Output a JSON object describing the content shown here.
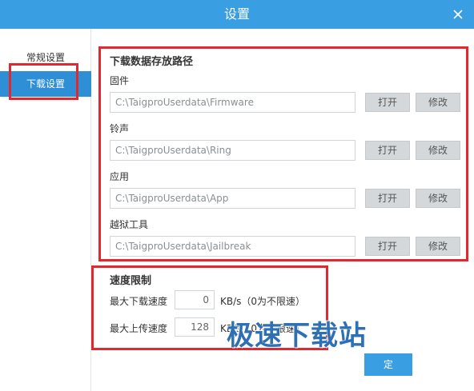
{
  "window": {
    "title": "设置"
  },
  "sidebar": {
    "items": [
      {
        "label": "常规设置"
      },
      {
        "label": "下载设置"
      }
    ]
  },
  "download_paths": {
    "title": "下载数据存放路径",
    "items": [
      {
        "label": "固件",
        "path": "C:\\TaigproUserdata\\Firmware",
        "open_label": "打开",
        "modify_label": "修改"
      },
      {
        "label": "铃声",
        "path": "C:\\TaigproUserdata\\Ring",
        "open_label": "打开",
        "modify_label": "修改"
      },
      {
        "label": "应用",
        "path": "C:\\TaigproUserdata\\App",
        "open_label": "打开",
        "modify_label": "修改"
      },
      {
        "label": "越狱工具",
        "path": "C:\\TaigproUserdata\\Jailbreak",
        "open_label": "打开",
        "modify_label": "修改"
      }
    ]
  },
  "speed_limit": {
    "title": "速度限制",
    "max_download": {
      "label": "最大下载速度",
      "value": "0",
      "unit": "KB/s（0为不限速）"
    },
    "max_upload": {
      "label": "最大上传速度",
      "value": "128",
      "unit": "KB/s（0为不限速）"
    }
  },
  "footer": {
    "confirm_label": "定"
  },
  "watermark": {
    "text": "极速下载站"
  },
  "colors": {
    "titlebar": "#3a9ee3",
    "active": "#2f8fd6",
    "highlight": "#e3272f"
  }
}
